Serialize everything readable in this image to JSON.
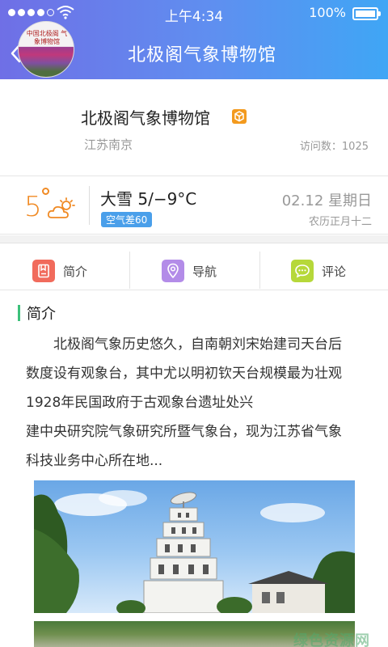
{
  "status_bar": {
    "time": "上午4:34",
    "battery": "100%",
    "battery_level": 1.0,
    "signal_bars_filled": 4,
    "signal_bars_total": 5
  },
  "nav": {
    "back_label": "返回",
    "title": "北极阁气象博物馆"
  },
  "profile": {
    "name": "北极阁气象博物馆",
    "location": "江苏南京",
    "visits": "访问数：1025",
    "avatar_text": "中国北极阁 气象博物馆"
  },
  "weather": {
    "temperature": "5",
    "condition": "大雪  5/−9°C",
    "aqi": "空气差60",
    "date": "02.12 星期日",
    "lunar": "农历正月十二"
  },
  "tabs": [
    {
      "label": "简介",
      "icon": "bookmark-icon",
      "color": "#f16b5c"
    },
    {
      "label": "导航",
      "icon": "location-pin-icon",
      "color": "#b38ce8"
    },
    {
      "label": "评论",
      "icon": "chat-bubble-icon",
      "color": "#b6d83a"
    }
  ],
  "intro": {
    "title": "简介",
    "lines": [
      "北极阁气象历史悠久，自南朝刘宋始建司天台后",
      "数度设有观象台，其中尤以明初钦天台规模最为壮观",
      "1928年民国政府于古观象台遗址处兴",
      "建中央研究院气象研究所暨气象台，现为江苏省气象",
      "科技业务中心所在地..."
    ]
  },
  "watermark": "绿色资源网",
  "colors": {
    "header_start": "#6f6fe6",
    "header_end": "#3fa6f5",
    "accent_orange": "#f08a24",
    "aqi_blue": "#4a9fea",
    "section_green": "#3cc07a"
  }
}
